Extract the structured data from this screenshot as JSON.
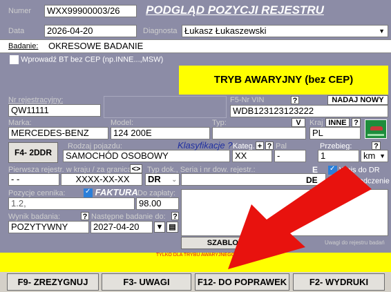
{
  "header": {
    "numer_label": "Numer",
    "numer_value": "WXX99900003/26",
    "title": "PODGLĄD POZYCJI REJESTRU",
    "data_label": "Data",
    "data_value": "2026-04-20",
    "diagnosta_label": "Diagnosta",
    "diagnosta_value": "Łukasz Łukaszewski",
    "badanie_label": "Badanie:",
    "badanie_value": "OKRESOWE BADANIE",
    "bt_checkbox_label": "Wprowadź BT bez CEP (np.INNE...,MSW)",
    "mode_banner": "TRYB AWARYJNY (bez CEP)"
  },
  "vehicle": {
    "nr_rej_label": "Nr rejestracyjny:",
    "nr_rej_value": "QW11111",
    "vin_label": "F5-Nr VIN",
    "vin_help": "?",
    "vin_value": "WDB123123123222",
    "nadaj_nowy": "NADAJ NOWY",
    "marka_label": "Marka:",
    "marka_value": "MERCEDES-BENZ",
    "model_label": "Model:",
    "model_value": "124 200E",
    "typ_label": "Typ:",
    "v_button": "V",
    "kraj_label": "Kraj",
    "inne_button": "INNE",
    "kraj_help": "?",
    "kraj_value": "PL",
    "f4_button": "F4- 2DDR",
    "rodzaj_label": "Rodzaj pojazdu:",
    "rodzaj_value": "SAMOCHÓD OSOBOWY",
    "klasyfikacje": "Klasyfikacje ?",
    "kateg_label": "Kateg.",
    "kateg_plus": "+",
    "kateg_help": "?",
    "kateg_value": "XX",
    "pal_label": "Pal",
    "pal_value": "-",
    "przebieg_label": "Przebieg:",
    "przebieg_help": "?",
    "przebieg_value": "1",
    "przebieg_unit": "km",
    "pierwsza_label": "Pierwsza rejestr. w kraju / za granicą",
    "swap_button": "<>",
    "pierwsza_value_1": "- -",
    "pierwsza_value_2": "XXXX-XX-XX",
    "typ_dok_label": "Typ dok., Seria i nr dow. rejestr.:",
    "typ_dok_value": "DR",
    "e_fragment": "E",
    "de_fragment": "DE",
    "wpis_dr": "Wpis do DR",
    "zaswiadczenie": "Zaświadczenie"
  },
  "pricing": {
    "pozycje_label": "Pozycje cennika:",
    "faktura_label": "FAKTURA",
    "do_zaplaty_label": "Do zapłaty:",
    "pozycje_value": "1.2,",
    "do_zaplaty_value": "98.00",
    "wynik_label": "Wynik badania:",
    "wynik_help": "?",
    "nastepne_label": "Następne badanie do:",
    "nastepne_help": "?",
    "wynik_value": "POZYTYWNY",
    "nastepne_value": "2027-04-20",
    "szablony": "SZABLONY",
    "uwagi_rejestr": "Uwagi do rejestru badań",
    "tylko_awaryjny": "TYLKO DLA TRYBU AWARYJNEGO"
  },
  "footer": {
    "f9": "F9- ZREZYGNUJ",
    "f3": "F3- UWAGI",
    "f12": "F12- DO POPRAWEK",
    "f2": "F2- WYDRUKI"
  },
  "icons": {
    "dropdown": "chevron-down-icon",
    "calendar": "calendar-icon",
    "car": "car-icon"
  },
  "colors": {
    "header_bg": "#8c8ca6",
    "banner": "#ffff00",
    "title": "#ffffff",
    "klasyfikacje": "#1f2fa0",
    "arrow": "#e8120e"
  }
}
